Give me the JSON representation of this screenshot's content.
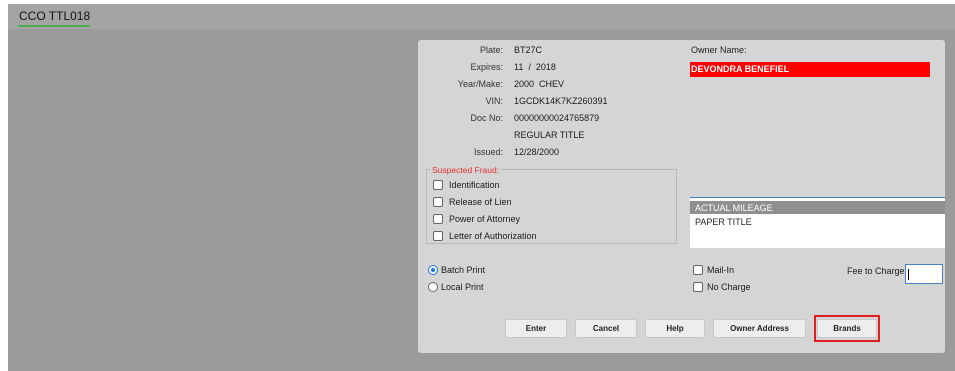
{
  "app": {
    "title": "CCO TTL018"
  },
  "vehicle": {
    "plate_label": "Plate:",
    "plate": "BT27C",
    "expires_label": "Expires:",
    "expires": "11  /  2018",
    "yearmake_label": "Year/Make:",
    "yearmake": "2000  CHEV",
    "vin_label": "VIN:",
    "vin": "1GCDK14K7KZ260391",
    "docno_label": "Doc No:",
    "docno": "00000000024765879",
    "title_type": "REGULAR TITLE",
    "issued_label": "Issued:",
    "issued": "12/28/2000"
  },
  "owner": {
    "label": "Owner Name:",
    "name": "DEVONDRA BENEFIEL"
  },
  "fraud": {
    "legend": "Suspected Fraud:",
    "options": [
      {
        "label": "Identification",
        "checked": false
      },
      {
        "label": "Release of Lien",
        "checked": false
      },
      {
        "label": "Power of Attorney",
        "checked": false
      },
      {
        "label": "Letter of Authorization",
        "checked": false
      }
    ]
  },
  "brands_list": {
    "selected": "ACTUAL MILEAGE",
    "items": [
      "PAPER TITLE"
    ]
  },
  "print": {
    "batch": "Batch Print",
    "local": "Local Print",
    "selected": "batch"
  },
  "options": {
    "mail_in": "Mail-In",
    "no_charge": "No Charge"
  },
  "fee": {
    "label": "Fee to Charge:",
    "value": ""
  },
  "buttons": {
    "enter": "Enter",
    "cancel": "Cancel",
    "help": "Help",
    "owner_address": "Owner Address",
    "brands": "Brands"
  },
  "colors": {
    "owner_highlight": "#ff0000",
    "fraud_legend": "#e53030",
    "selection": "#8f8f8f",
    "highlight_box": "#e02020"
  }
}
